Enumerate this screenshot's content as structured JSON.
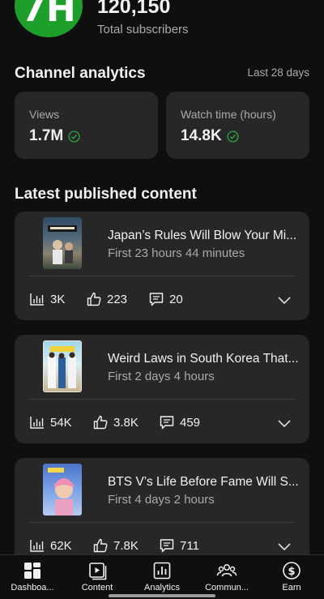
{
  "channel": {
    "subscriber_count": "120,150",
    "subscriber_label": "Total subscribers",
    "avatar_letters": "7H",
    "avatar_color": "#1e9e2a"
  },
  "analytics": {
    "title": "Channel analytics",
    "range": "Last 28 days",
    "views_label": "Views",
    "views_value": "1.7M",
    "watch_label": "Watch time (hours)",
    "watch_value": "14.8K",
    "check_color": "#2ba640"
  },
  "latest": {
    "title": "Latest published content",
    "items": [
      {
        "title": "Japan’s Rules Will Blow Your Mi...",
        "subtitle": "First 23 hours 44 minutes",
        "views": "3K",
        "likes": "223",
        "comments": "20"
      },
      {
        "title": "Weird Laws in South Korea That...",
        "subtitle": "First 2 days 4 hours",
        "views": "54K",
        "likes": "3.8K",
        "comments": "459"
      },
      {
        "title": "BTS V’s Life Before Fame Will S...",
        "subtitle": "First 4 days 2 hours",
        "views": "62K",
        "likes": "7.8K",
        "comments": "711"
      }
    ]
  },
  "nav": {
    "items": [
      {
        "label": "Dashboa...",
        "icon": "dashboard-icon"
      },
      {
        "label": "Content",
        "icon": "content-icon"
      },
      {
        "label": "Analytics",
        "icon": "analytics-icon"
      },
      {
        "label": "Commun...",
        "icon": "community-icon"
      },
      {
        "label": "Earn",
        "icon": "earn-icon"
      }
    ]
  }
}
